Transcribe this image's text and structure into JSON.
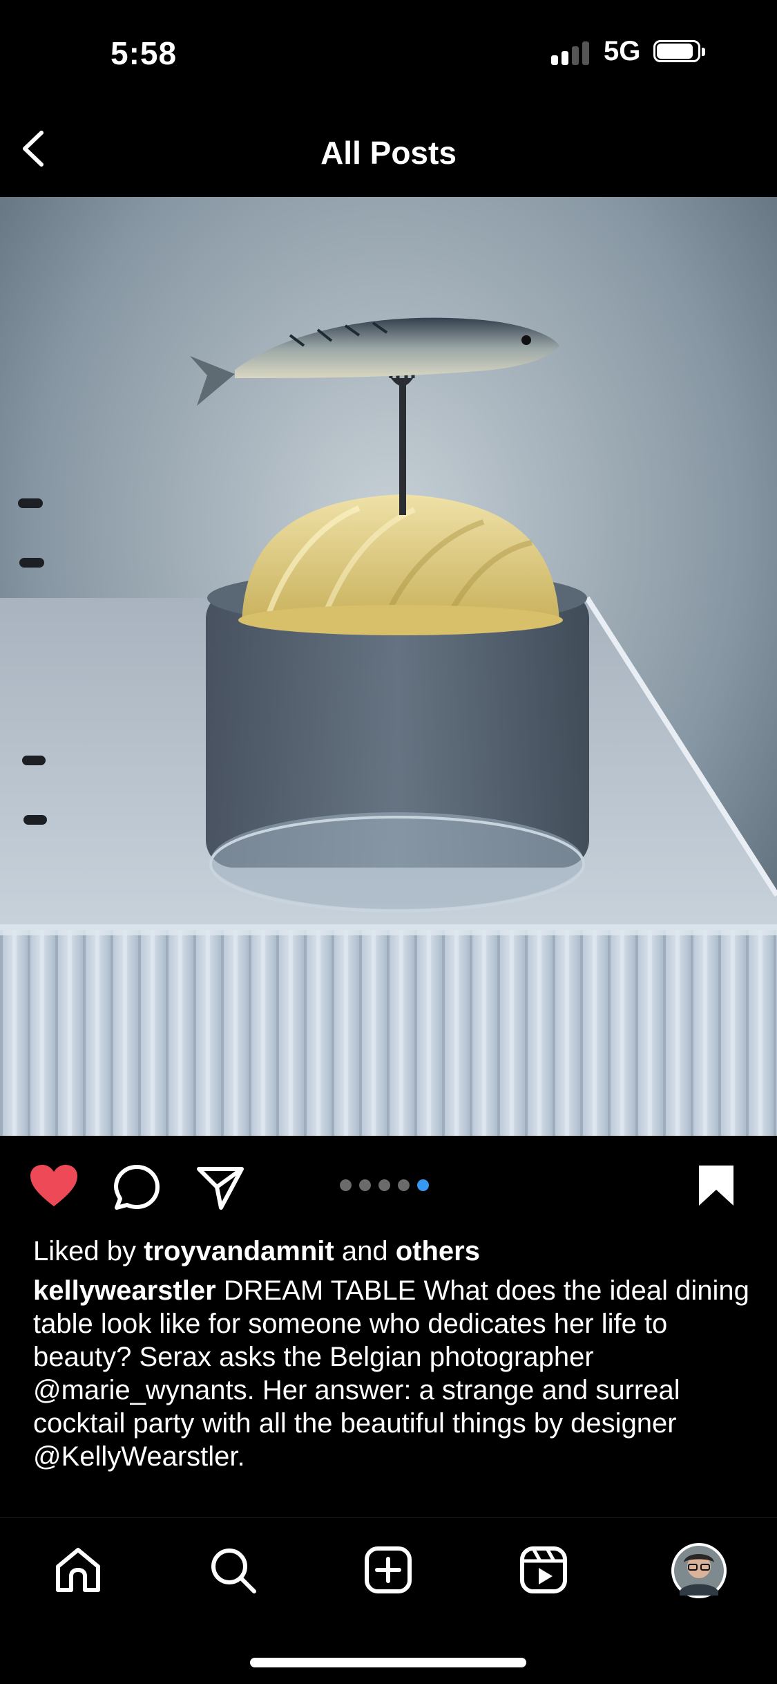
{
  "status_bar": {
    "time": "5:58",
    "network": "5G",
    "signal_bars_filled": 2,
    "signal_bars_total": 4,
    "battery_level": 0.85
  },
  "header": {
    "title": "All Posts"
  },
  "post": {
    "image_description_icon": "photo-dream-table",
    "carousel": {
      "count": 5,
      "active_index": 4
    },
    "liked": true,
    "likes": {
      "prefix": "Liked by",
      "user": "troyvandamnit",
      "middle": "and",
      "suffix": "others"
    },
    "caption": {
      "username": "kellywearstler",
      "text": "DREAM TABLE What does the ideal dining table look like for someone who dedicates her life to beauty? Serax asks the Belgian photographer @marie_wynants. Her answer: a strange and surreal cocktail party with all the beautiful things by designer @KellyWearstler."
    }
  },
  "tabs": [
    {
      "name": "home",
      "icon": "home-icon"
    },
    {
      "name": "search",
      "icon": "search-icon"
    },
    {
      "name": "create",
      "icon": "plus-square-icon"
    },
    {
      "name": "reels",
      "icon": "reels-icon"
    },
    {
      "name": "profile",
      "icon": "avatar"
    }
  ],
  "colors": {
    "like": "#ed4956",
    "carousel_active": "#3897f0",
    "background": "#000000"
  }
}
